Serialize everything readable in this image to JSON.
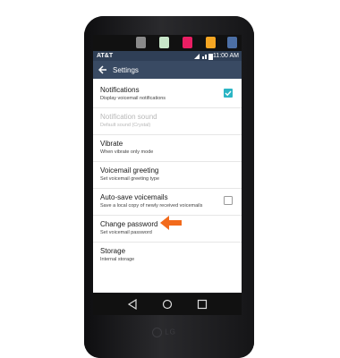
{
  "status": {
    "carrier": "AT&T",
    "time": "11:00 AM"
  },
  "header": {
    "title": "Settings"
  },
  "settings": [
    {
      "title": "Notifications",
      "subtitle": "Display voicemail notifications",
      "checkbox": true,
      "checked": true,
      "enabled": true
    },
    {
      "title": "Notification sound",
      "subtitle": "Default sound (Crystal)",
      "enabled": false
    },
    {
      "title": "Vibrate",
      "subtitle": "When vibrate only mode",
      "enabled": true
    },
    {
      "title": "Voicemail greeting",
      "subtitle": "Set voicemail greeting type",
      "enabled": true
    },
    {
      "title": "Auto-save voicemails",
      "subtitle": "Save a local copy of newly received voicemails",
      "checkbox": true,
      "checked": false,
      "enabled": true
    },
    {
      "title": "Change password",
      "subtitle": "Set voicemail password",
      "enabled": true,
      "highlighted": true
    },
    {
      "title": "Storage",
      "subtitle": "Internal storage",
      "enabled": true
    }
  ],
  "brand": "LG",
  "colors": {
    "accent": "#2bb5c4",
    "appbar": "#394a63",
    "statusbar": "#2f3f56",
    "arrow": "#f26a1b"
  },
  "icons": {
    "back": "arrow-left-icon",
    "annotation": "orange-arrow-icon"
  }
}
